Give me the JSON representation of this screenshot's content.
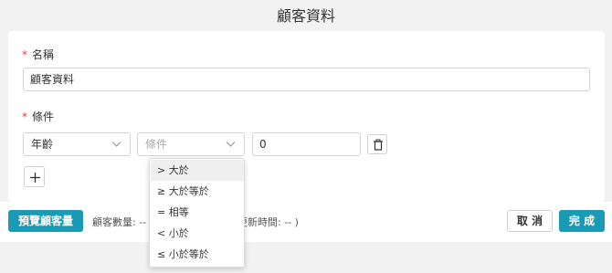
{
  "header": {
    "title": "顧客資料"
  },
  "form": {
    "name": {
      "required_mark": "*",
      "label": "名稱",
      "value": "顧客資料"
    },
    "condition": {
      "required_mark": "*",
      "label": "條件",
      "field_select": {
        "value": "年齡"
      },
      "operator_select": {
        "placeholder": "條件"
      },
      "value_input": {
        "value": "0"
      },
      "delete_icon": "trash-icon",
      "add_icon": "plus-icon"
    }
  },
  "dropdown": {
    "options": [
      {
        "label": "> 大於"
      },
      {
        "label": "≥ 大於等於"
      },
      {
        "label": "= 相等"
      },
      {
        "label": "< 小於"
      },
      {
        "label": "≤ 小於等於"
      }
    ]
  },
  "footer": {
    "preview_label": "預覽顧客量",
    "customer_count_text": "顧客數量: --",
    "update_time_text": "更新時間: -- )",
    "cancel_label": "取 消",
    "done_label": "完 成"
  },
  "colors": {
    "primary": "#1a9bb5",
    "required": "#e04040",
    "background": "#f2f2f2"
  }
}
